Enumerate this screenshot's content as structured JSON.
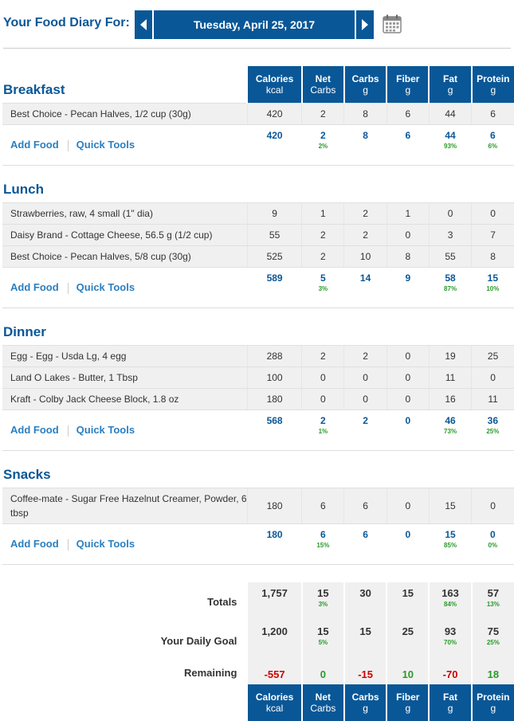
{
  "header": {
    "label": "Your Food Diary For:",
    "date": "Tuesday, April 25, 2017"
  },
  "columns": [
    {
      "name": "Calories",
      "unit": "kcal"
    },
    {
      "name": "Net",
      "unit": "Carbs"
    },
    {
      "name": "Carbs",
      "unit": "g"
    },
    {
      "name": "Fiber",
      "unit": "g"
    },
    {
      "name": "Fat",
      "unit": "g"
    },
    {
      "name": "Protein",
      "unit": "g"
    }
  ],
  "links": {
    "add_food": "Add Food",
    "quick_tools": "Quick Tools"
  },
  "meals": [
    {
      "title": "Breakfast",
      "foods": [
        {
          "name": "Best Choice - Pecan Halves, 1/2 cup (30g)",
          "values": [
            "420",
            "2",
            "8",
            "6",
            "44",
            "6"
          ]
        }
      ],
      "sum": [
        "420",
        "2",
        "8",
        "6",
        "44",
        "6"
      ],
      "pct": [
        "",
        "2%",
        "",
        "",
        "93%",
        "6%"
      ]
    },
    {
      "title": "Lunch",
      "foods": [
        {
          "name": "Strawberries, raw, 4 small (1\" dia)",
          "values": [
            "9",
            "1",
            "2",
            "1",
            "0",
            "0"
          ]
        },
        {
          "name": "Daisy Brand - Cottage Cheese, 56.5 g (1/2 cup)",
          "values": [
            "55",
            "2",
            "2",
            "0",
            "3",
            "7"
          ]
        },
        {
          "name": "Best Choice - Pecan Halves, 5/8 cup (30g)",
          "values": [
            "525",
            "2",
            "10",
            "8",
            "55",
            "8"
          ]
        }
      ],
      "sum": [
        "589",
        "5",
        "14",
        "9",
        "58",
        "15"
      ],
      "pct": [
        "",
        "3%",
        "",
        "",
        "87%",
        "10%"
      ]
    },
    {
      "title": "Dinner",
      "foods": [
        {
          "name": "Egg - Egg - Usda Lg, 4 egg",
          "values": [
            "288",
            "2",
            "2",
            "0",
            "19",
            "25"
          ]
        },
        {
          "name": "Land O Lakes - Butter, 1 Tbsp",
          "values": [
            "100",
            "0",
            "0",
            "0",
            "11",
            "0"
          ]
        },
        {
          "name": "Kraft - Colby Jack Cheese Block, 1.8 oz",
          "values": [
            "180",
            "0",
            "0",
            "0",
            "16",
            "11"
          ]
        }
      ],
      "sum": [
        "568",
        "2",
        "2",
        "0",
        "46",
        "36"
      ],
      "pct": [
        "",
        "1%",
        "",
        "",
        "73%",
        "25%"
      ]
    },
    {
      "title": "Snacks",
      "foods": [
        {
          "name": "Coffee-mate - Sugar Free Hazelnut Creamer, Powder, 6 tbsp",
          "values": [
            "180",
            "6",
            "6",
            "0",
            "15",
            "0"
          ]
        }
      ],
      "sum": [
        "180",
        "6",
        "6",
        "0",
        "15",
        "0"
      ],
      "pct": [
        "",
        "15%",
        "",
        "",
        "85%",
        "0%"
      ]
    }
  ],
  "totals": {
    "label": "Totals",
    "values": [
      "1,757",
      "15",
      "30",
      "15",
      "163",
      "57"
    ],
    "pct": [
      "",
      "3%",
      "",
      "",
      "84%",
      "13%"
    ]
  },
  "goal": {
    "label": "Your Daily Goal",
    "values": [
      "1,200",
      "15",
      "15",
      "25",
      "93",
      "75"
    ],
    "pct": [
      "",
      "5%",
      "",
      "",
      "70%",
      "25%"
    ]
  },
  "remaining": {
    "label": "Remaining",
    "values": [
      "-557",
      "0",
      "-15",
      "10",
      "-70",
      "18"
    ]
  },
  "colors": {
    "brand": "#0a5797",
    "link": "#2a7fc1",
    "positive": "#2a9a2a",
    "negative": "#d10000"
  }
}
